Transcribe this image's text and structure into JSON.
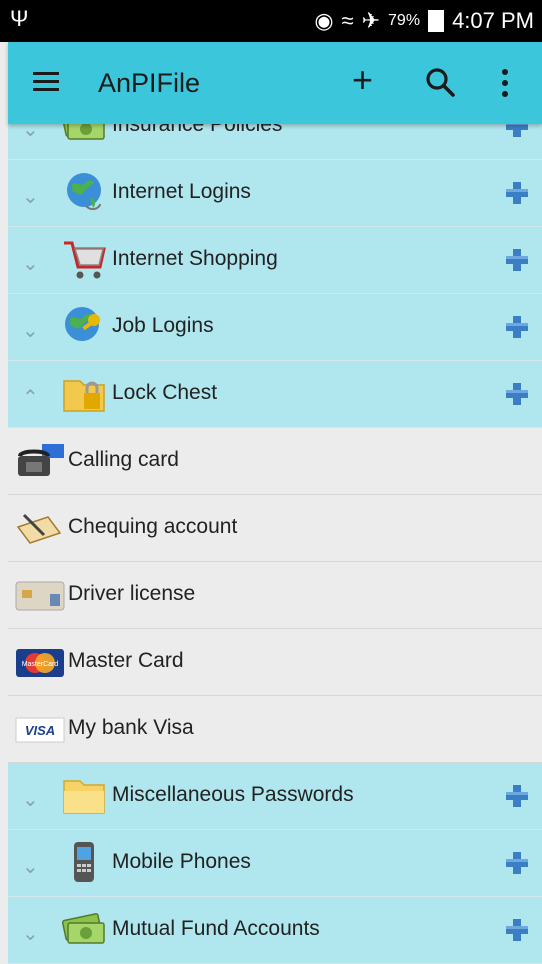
{
  "status": {
    "usb_icon": "usb-icon",
    "battery_pct": "79%",
    "time": "4:07 PM"
  },
  "appbar": {
    "title": "AnPIFile",
    "add_label": "+"
  },
  "partial_group": {
    "label": "Insurance Policies"
  },
  "groups_before": [
    {
      "label": "Internet Logins",
      "icon": "globe-icon"
    },
    {
      "label": "Internet Shopping",
      "icon": "shopping-cart-icon"
    },
    {
      "label": "Job Logins",
      "icon": "globe-key-icon"
    }
  ],
  "expanded_group": {
    "label": "Lock Chest",
    "icon": "folder-lock-icon"
  },
  "children": [
    {
      "label": "Calling card",
      "icon": "phone-card-icon"
    },
    {
      "label": "Chequing account",
      "icon": "cheque-pen-icon"
    },
    {
      "label": "Driver license",
      "icon": "license-card-icon"
    },
    {
      "label": "Master Card",
      "icon": "mastercard-icon",
      "icon_text": "MasterCard"
    },
    {
      "label": "My bank Visa",
      "icon": "visa-icon",
      "icon_text": "VISA"
    }
  ],
  "groups_after": [
    {
      "label": "Miscellaneous Passwords",
      "icon": "folder-icon"
    },
    {
      "label": "Mobile Phones",
      "icon": "mobile-phone-icon"
    },
    {
      "label": "Mutual Fund Accounts",
      "icon": "money-icon"
    }
  ],
  "colors": {
    "accent": "#3bc6db",
    "group_bg": "#b0e6ee",
    "child_bg": "#ececec",
    "plus": "#3a7fc4"
  }
}
